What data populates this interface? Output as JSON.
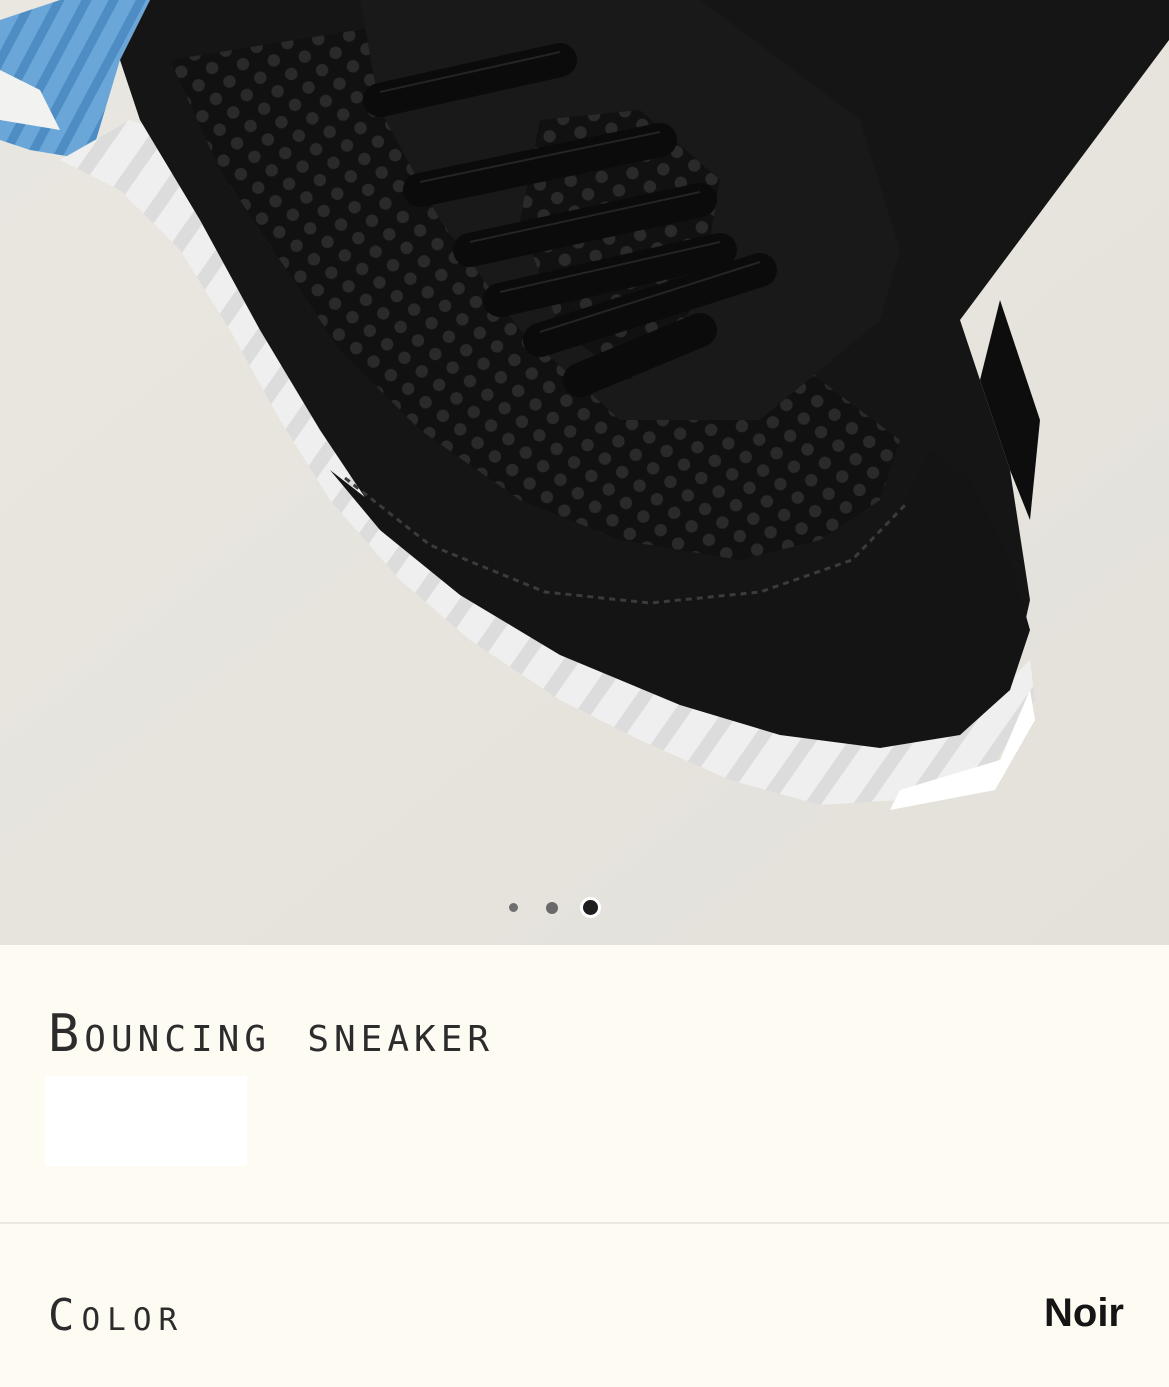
{
  "gallery": {
    "image_name": "black mesh and suede sneaker with white stepped sole",
    "dots": {
      "count": 3,
      "active_index": 3
    }
  },
  "product": {
    "title": "Bouncing sneaker"
  },
  "options": {
    "color_label": "Color",
    "color_value": "Noir"
  },
  "colors": {
    "page_background": "#fefbf3",
    "image_background": "#e7e5de",
    "text": "#2c2c2c",
    "divider": "#ebe8e1"
  }
}
